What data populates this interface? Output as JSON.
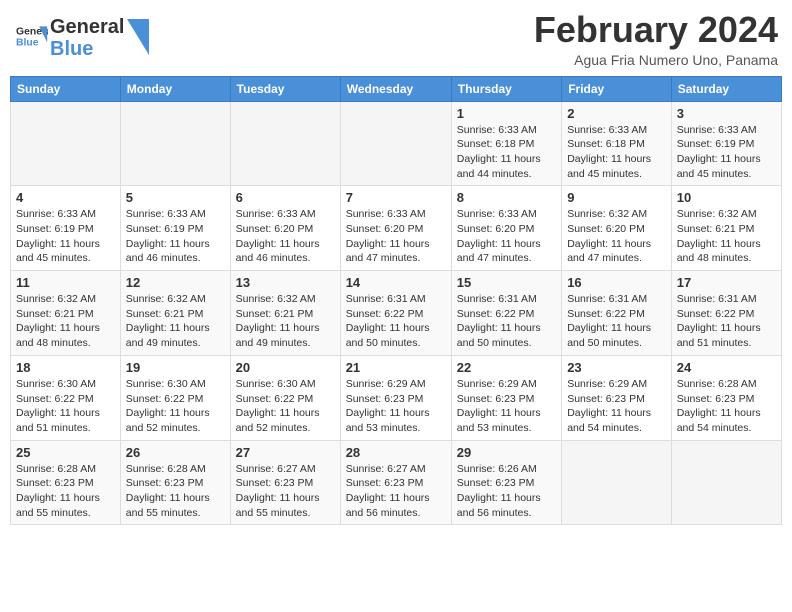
{
  "header": {
    "logo_line1": "General",
    "logo_line2": "Blue",
    "month": "February 2024",
    "location": "Agua Fria Numero Uno, Panama"
  },
  "weekdays": [
    "Sunday",
    "Monday",
    "Tuesday",
    "Wednesday",
    "Thursday",
    "Friday",
    "Saturday"
  ],
  "weeks": [
    [
      {
        "day": "",
        "info": ""
      },
      {
        "day": "",
        "info": ""
      },
      {
        "day": "",
        "info": ""
      },
      {
        "day": "",
        "info": ""
      },
      {
        "day": "1",
        "info": "Sunrise: 6:33 AM\nSunset: 6:18 PM\nDaylight: 11 hours\nand 44 minutes."
      },
      {
        "day": "2",
        "info": "Sunrise: 6:33 AM\nSunset: 6:18 PM\nDaylight: 11 hours\nand 45 minutes."
      },
      {
        "day": "3",
        "info": "Sunrise: 6:33 AM\nSunset: 6:19 PM\nDaylight: 11 hours\nand 45 minutes."
      }
    ],
    [
      {
        "day": "4",
        "info": "Sunrise: 6:33 AM\nSunset: 6:19 PM\nDaylight: 11 hours\nand 45 minutes."
      },
      {
        "day": "5",
        "info": "Sunrise: 6:33 AM\nSunset: 6:19 PM\nDaylight: 11 hours\nand 46 minutes."
      },
      {
        "day": "6",
        "info": "Sunrise: 6:33 AM\nSunset: 6:20 PM\nDaylight: 11 hours\nand 46 minutes."
      },
      {
        "day": "7",
        "info": "Sunrise: 6:33 AM\nSunset: 6:20 PM\nDaylight: 11 hours\nand 47 minutes."
      },
      {
        "day": "8",
        "info": "Sunrise: 6:33 AM\nSunset: 6:20 PM\nDaylight: 11 hours\nand 47 minutes."
      },
      {
        "day": "9",
        "info": "Sunrise: 6:32 AM\nSunset: 6:20 PM\nDaylight: 11 hours\nand 47 minutes."
      },
      {
        "day": "10",
        "info": "Sunrise: 6:32 AM\nSunset: 6:21 PM\nDaylight: 11 hours\nand 48 minutes."
      }
    ],
    [
      {
        "day": "11",
        "info": "Sunrise: 6:32 AM\nSunset: 6:21 PM\nDaylight: 11 hours\nand 48 minutes."
      },
      {
        "day": "12",
        "info": "Sunrise: 6:32 AM\nSunset: 6:21 PM\nDaylight: 11 hours\nand 49 minutes."
      },
      {
        "day": "13",
        "info": "Sunrise: 6:32 AM\nSunset: 6:21 PM\nDaylight: 11 hours\nand 49 minutes."
      },
      {
        "day": "14",
        "info": "Sunrise: 6:31 AM\nSunset: 6:22 PM\nDaylight: 11 hours\nand 50 minutes."
      },
      {
        "day": "15",
        "info": "Sunrise: 6:31 AM\nSunset: 6:22 PM\nDaylight: 11 hours\nand 50 minutes."
      },
      {
        "day": "16",
        "info": "Sunrise: 6:31 AM\nSunset: 6:22 PM\nDaylight: 11 hours\nand 50 minutes."
      },
      {
        "day": "17",
        "info": "Sunrise: 6:31 AM\nSunset: 6:22 PM\nDaylight: 11 hours\nand 51 minutes."
      }
    ],
    [
      {
        "day": "18",
        "info": "Sunrise: 6:30 AM\nSunset: 6:22 PM\nDaylight: 11 hours\nand 51 minutes."
      },
      {
        "day": "19",
        "info": "Sunrise: 6:30 AM\nSunset: 6:22 PM\nDaylight: 11 hours\nand 52 minutes."
      },
      {
        "day": "20",
        "info": "Sunrise: 6:30 AM\nSunset: 6:22 PM\nDaylight: 11 hours\nand 52 minutes."
      },
      {
        "day": "21",
        "info": "Sunrise: 6:29 AM\nSunset: 6:23 PM\nDaylight: 11 hours\nand 53 minutes."
      },
      {
        "day": "22",
        "info": "Sunrise: 6:29 AM\nSunset: 6:23 PM\nDaylight: 11 hours\nand 53 minutes."
      },
      {
        "day": "23",
        "info": "Sunrise: 6:29 AM\nSunset: 6:23 PM\nDaylight: 11 hours\nand 54 minutes."
      },
      {
        "day": "24",
        "info": "Sunrise: 6:28 AM\nSunset: 6:23 PM\nDaylight: 11 hours\nand 54 minutes."
      }
    ],
    [
      {
        "day": "25",
        "info": "Sunrise: 6:28 AM\nSunset: 6:23 PM\nDaylight: 11 hours\nand 55 minutes."
      },
      {
        "day": "26",
        "info": "Sunrise: 6:28 AM\nSunset: 6:23 PM\nDaylight: 11 hours\nand 55 minutes."
      },
      {
        "day": "27",
        "info": "Sunrise: 6:27 AM\nSunset: 6:23 PM\nDaylight: 11 hours\nand 55 minutes."
      },
      {
        "day": "28",
        "info": "Sunrise: 6:27 AM\nSunset: 6:23 PM\nDaylight: 11 hours\nand 56 minutes."
      },
      {
        "day": "29",
        "info": "Sunrise: 6:26 AM\nSunset: 6:23 PM\nDaylight: 11 hours\nand 56 minutes."
      },
      {
        "day": "",
        "info": ""
      },
      {
        "day": "",
        "info": ""
      }
    ]
  ]
}
